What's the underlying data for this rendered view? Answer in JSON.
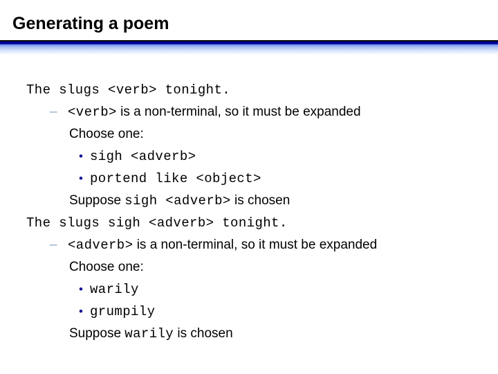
{
  "slide": {
    "title": "Generating a poem",
    "divider": {
      "rule_color": "#000000",
      "accent_color": "#0000a0",
      "fade_color": "#a9c0f2"
    }
  },
  "markers": {
    "dash": "–",
    "dash_color": "#8fa8c8",
    "dot": "•",
    "dot_color": "#141496"
  },
  "body": {
    "lines": [
      {
        "id": "line-1",
        "level": 0,
        "marker": "none",
        "runs": [
          {
            "style": "mono",
            "text": "The slugs <verb> tonight."
          }
        ]
      },
      {
        "id": "line-2",
        "level": 1,
        "marker": "dash",
        "runs": [
          {
            "style": "mono",
            "text": "<verb>"
          },
          {
            "style": "sans",
            "text": " is a non-terminal, so it must be expanded"
          }
        ]
      },
      {
        "id": "line-3",
        "level": 2,
        "marker": "none",
        "runs": [
          {
            "style": "sans",
            "text": "Choose one:"
          }
        ]
      },
      {
        "id": "line-4",
        "level": 3,
        "marker": "dot",
        "runs": [
          {
            "style": "mono",
            "text": "sigh <adverb>"
          }
        ]
      },
      {
        "id": "line-5",
        "level": 3,
        "marker": "dot",
        "runs": [
          {
            "style": "mono",
            "text": "portend like <object>"
          }
        ]
      },
      {
        "id": "line-6",
        "level": 2,
        "marker": "none",
        "runs": [
          {
            "style": "sans",
            "text": "Suppose "
          },
          {
            "style": "mono",
            "text": "sigh <adverb>"
          },
          {
            "style": "sans",
            "text": " is chosen"
          }
        ]
      },
      {
        "id": "line-7",
        "level": 0,
        "marker": "none",
        "runs": [
          {
            "style": "mono",
            "text": "The slugs sigh <adverb> tonight."
          }
        ]
      },
      {
        "id": "line-8",
        "level": 1,
        "marker": "dash",
        "runs": [
          {
            "style": "mono",
            "text": "<adverb>"
          },
          {
            "style": "sans",
            "text": " is a non-terminal, so it must be expanded"
          }
        ]
      },
      {
        "id": "line-9",
        "level": 2,
        "marker": "none",
        "runs": [
          {
            "style": "sans",
            "text": "Choose one:"
          }
        ]
      },
      {
        "id": "line-10",
        "level": 3,
        "marker": "dot",
        "runs": [
          {
            "style": "mono",
            "text": "warily"
          }
        ]
      },
      {
        "id": "line-11",
        "level": 3,
        "marker": "dot",
        "runs": [
          {
            "style": "mono",
            "text": "grumpily"
          }
        ]
      },
      {
        "id": "line-12",
        "level": 2,
        "marker": "none",
        "runs": [
          {
            "style": "sans",
            "text": "Suppose "
          },
          {
            "style": "mono",
            "text": "warily"
          },
          {
            "style": "sans",
            "text": " is chosen"
          }
        ]
      }
    ]
  }
}
